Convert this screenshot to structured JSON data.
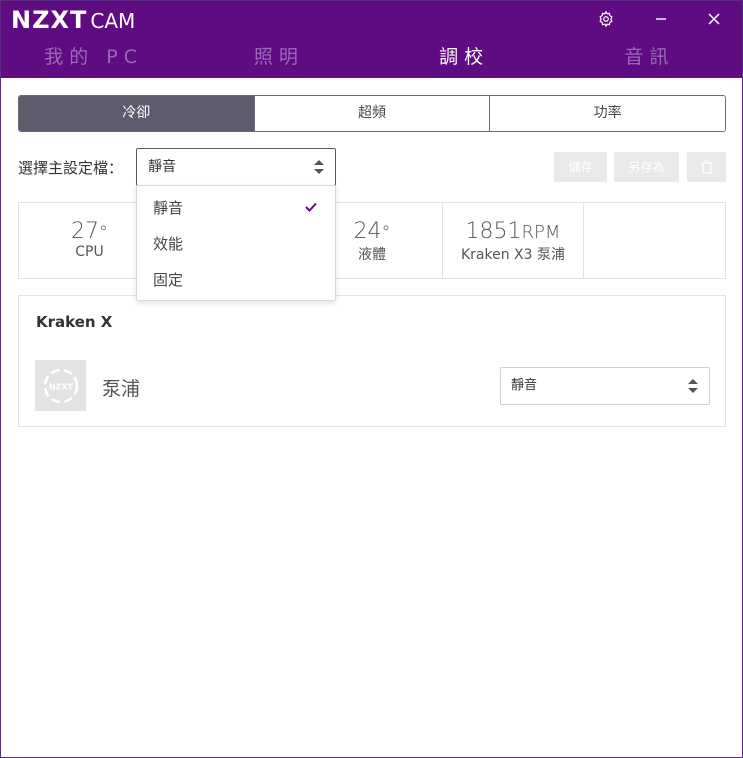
{
  "app": {
    "logo_bold": "NZXT",
    "logo_light": "CAM"
  },
  "window_controls": {
    "settings_icon": "gear-icon",
    "minimize_icon": "minimize-icon",
    "close_icon": "close-icon"
  },
  "nav": {
    "tabs": [
      {
        "label": "我的 PC",
        "active": false
      },
      {
        "label": "照明",
        "active": false
      },
      {
        "label": "調校",
        "active": true
      },
      {
        "label": "音訊",
        "active": false
      }
    ]
  },
  "subtabs": [
    {
      "label": "冷卻",
      "active": true
    },
    {
      "label": "超頻",
      "active": false
    },
    {
      "label": "功率",
      "active": false
    }
  ],
  "profile": {
    "label": "選擇主設定檔：",
    "selected": "靜音",
    "save_label": "儲存",
    "save_as_label": "另存為",
    "delete_icon": "trash-icon"
  },
  "dropdown": {
    "options": [
      {
        "label": "靜音",
        "checked": true
      },
      {
        "label": "效能",
        "checked": false
      },
      {
        "label": "固定",
        "checked": false
      }
    ]
  },
  "stats": [
    {
      "value": "27",
      "unit": "°",
      "label": "CPU"
    },
    {
      "value": "",
      "unit": "",
      "label": ""
    },
    {
      "value": "24",
      "unit": "°",
      "label": "液體"
    },
    {
      "value": "1851",
      "unit": "RPM",
      "label": "Kraken X3 泵浦"
    },
    {
      "value": "",
      "unit": "",
      "label": ""
    }
  ],
  "device": {
    "title": "Kraken X",
    "icon_text": "NZXT",
    "name": "泵浦",
    "profile": "靜音"
  },
  "colors": {
    "brand_purple": "#5f0c82",
    "inactive_tab": "#9a68b6",
    "active_subtab": "#5c5c6d",
    "check_purple": "#5f0c82"
  }
}
